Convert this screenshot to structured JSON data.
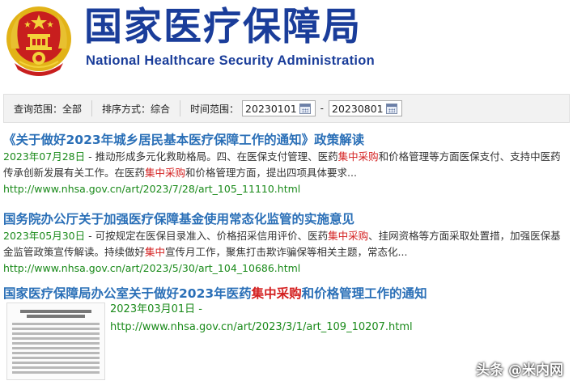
{
  "header": {
    "title_cn": "国家医疗保障局",
    "title_en": "National Healthcare Security Administration"
  },
  "filters": {
    "scope": "查询范围：全部",
    "sort": "排序方式：综合",
    "time_label": "时间范围：",
    "date_from": "20230101",
    "date_to": "20230801",
    "dash": "-"
  },
  "results": [
    {
      "title": "《关于做好2023年城乡居民基本医疗保障工作的通知》政策解读",
      "date": "2023年07月28日",
      "snippet_parts": [
        " - 推动形成多元化救助格局。四、在医保支付管理、医药",
        "集中采购",
        "和价格管理等方面医保支付、支持中医药传承创新发展有关工作。在医药",
        "集中采购",
        "和价格管理方面，提出四项具体要求..."
      ],
      "url": "http://www.nhsa.gov.cn/art/2023/7/28/art_105_11110.html"
    },
    {
      "title": "国务院办公厅关于加强医疗保障基金使用常态化监管的实施意见",
      "date": "2023年05月30日",
      "snippet_parts": [
        " - 可按规定在医保目录准入、价格招采信用评价、医药",
        "集中采购",
        "、挂网资格等方面采取处置措，加强医保基金监管政策宣传解读。持续做好",
        "集中",
        "宣传月工作，聚焦打击欺诈骗保等相关主题，常态化..."
      ],
      "url": "http://www.nhsa.gov.cn/art/2023/5/30/art_104_10686.html"
    },
    {
      "title_pre": "国家医疗保障局办公室关于做好2023年医药",
      "title_hl": "集中采购",
      "title_post": "和价格管理工作的通知",
      "date": "2023年03月01日",
      "date_suffix": " -",
      "url": "http://www.nhsa.gov.cn/art/2023/3/1/art_109_10207.html"
    }
  ],
  "watermark": "头条 @米内网",
  "colors": {
    "brand": "#1a3d9a",
    "link": "#2a6fb7",
    "highlight": "#d42020",
    "meta_green": "#1a8a1a"
  },
  "icons": {
    "emblem": "national-emblem-icon",
    "calendar": "calendar-icon"
  }
}
